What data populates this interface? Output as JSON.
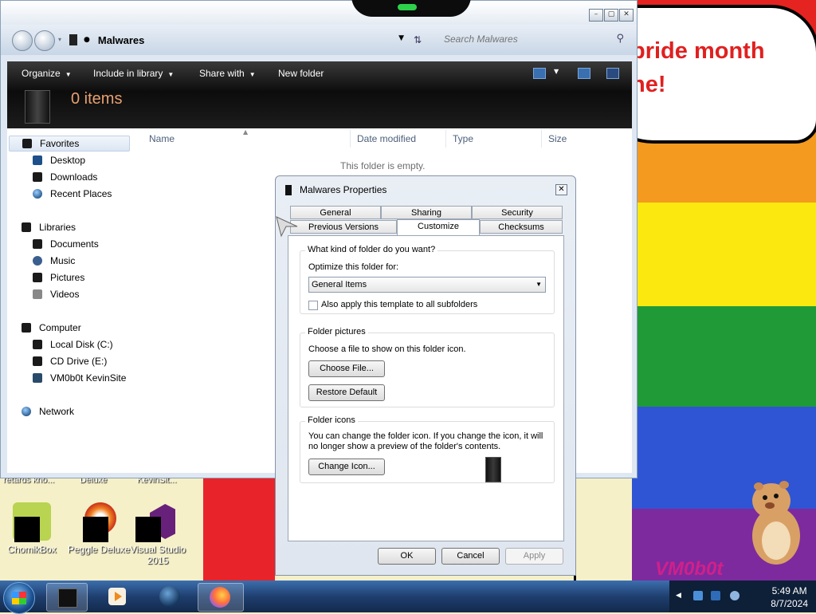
{
  "desktop": {
    "speech_line1": "pride month",
    "speech_line2": "ne!",
    "logo_text": "VM0b0t",
    "partial_labels": [
      "retards kno...",
      "Deluxe",
      "KevinSit..."
    ],
    "icons": [
      {
        "label": "ChomikBox",
        "icon": "chomikbox-icon"
      },
      {
        "label": "Peggle Deluxe",
        "icon": "peggle-icon"
      },
      {
        "label": "Visual Studio 2015",
        "icon": "visual-studio-icon"
      }
    ]
  },
  "explorer": {
    "address": "Malwares",
    "search_placeholder": "Search Malwares",
    "toolbar": {
      "organize": "Organize",
      "include_in_library": "Include in library",
      "share_with": "Share with",
      "new_folder": "New folder"
    },
    "items_count": "0 items",
    "nav": {
      "favorites": "Favorites",
      "desktop": "Desktop",
      "downloads": "Downloads",
      "recent_places": "Recent Places",
      "libraries": "Libraries",
      "documents": "Documents",
      "music": "Music",
      "pictures": "Pictures",
      "videos": "Videos",
      "computer": "Computer",
      "local_disk": "Local Disk (C:)",
      "cd_drive": "CD Drive (E:)",
      "vm_site": "VM0b0t KevinSite",
      "network": "Network"
    },
    "columns": {
      "name": "Name",
      "date_modified": "Date modified",
      "type": "Type",
      "size": "Size"
    },
    "empty_message": "This folder is empty."
  },
  "dialog": {
    "title": "Malwares Properties",
    "tabs": {
      "general": "General",
      "sharing": "Sharing",
      "security": "Security",
      "previous_versions": "Previous Versions",
      "customize": "Customize",
      "checksums": "Checksums"
    },
    "what_kind": "What kind of folder do you want?",
    "optimize_label": "Optimize this folder for:",
    "optimize_value": "General Items",
    "apply_subfolders": "Also apply this template to all subfolders",
    "folder_pictures": "Folder pictures",
    "choose_file_text": "Choose a file to show on this folder icon.",
    "choose_file_btn": "Choose File...",
    "restore_default_btn": "Restore Default",
    "folder_icons": "Folder icons",
    "icon_desc_1": "You can change the folder icon. If you change the icon, it will",
    "icon_desc_2": "no longer show a preview of the folder's contents.",
    "change_icon_btn": "Change Icon...",
    "ok": "OK",
    "cancel": "Cancel",
    "apply": "Apply"
  },
  "taskbar": {
    "time": "5:49 AM",
    "date": "8/7/2024"
  },
  "colors": {
    "pride": [
      "#e52320",
      "#f39a1f",
      "#fbe80f",
      "#1f9a36",
      "#2f55d4",
      "#7d2a9e"
    ]
  }
}
